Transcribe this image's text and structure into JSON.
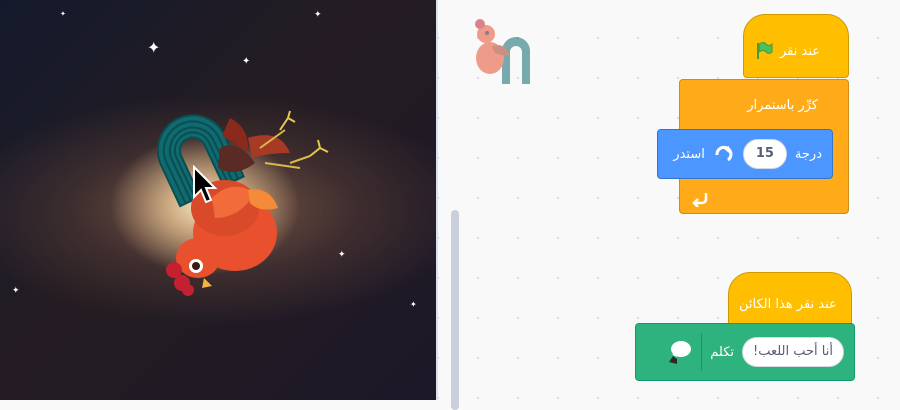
{
  "stage": {
    "backdrop": "galaxy",
    "sprites": [
      "rooster-sprite",
      "magnet-sprite"
    ]
  },
  "scripts": {
    "flag_hat": {
      "label": "عند نقر",
      "icon": "green-flag-icon"
    },
    "forever": {
      "label": "كرِّر باستمرار"
    },
    "turn": {
      "label": "استدر",
      "value": "15",
      "unit": "درجة",
      "icon": "rotate-right-icon"
    },
    "sprite_hat": {
      "label": "عند نقر هذا الكائن"
    },
    "say": {
      "label": "تكلم",
      "value": "أنا أحب اللعب!",
      "icon": "speech-icon"
    }
  },
  "colors": {
    "event": "#ffbf00",
    "control": "#ffab19",
    "motion": "#4c97ff",
    "looks": "#2fb37e"
  }
}
